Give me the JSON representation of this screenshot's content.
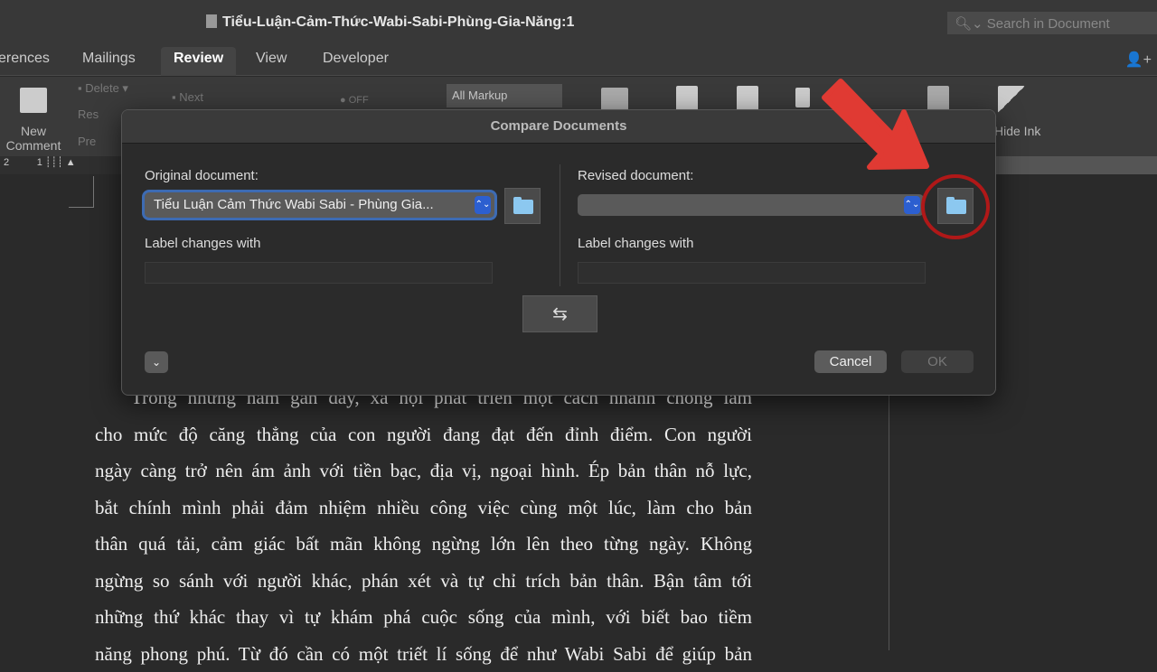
{
  "window": {
    "title": "Tiểu-Luận-Cảm-Thức-Wabi-Sabi-Phùng-Gia-Năng:1",
    "search_placeholder": "Search in Document"
  },
  "tabs": [
    {
      "label": "erences"
    },
    {
      "label": "Mailings"
    },
    {
      "label": "Review",
      "active": true
    },
    {
      "label": "View"
    },
    {
      "label": "Developer"
    }
  ],
  "ribbon": {
    "new_comment": "New Comment",
    "delete": "Delete",
    "next": "Next",
    "resolve": "Res",
    "previous": "Pre",
    "track_toggle": "OFF",
    "markup": "All Markup",
    "hide_ink": "Hide Ink"
  },
  "ruler": {
    "labels": [
      "2",
      "1"
    ]
  },
  "dialog": {
    "title": "Compare Documents",
    "original_label": "Original document:",
    "original_value": "Tiểu Luận Cảm Thức Wabi Sabi - Phùng Gia...",
    "revised_label": "Revised document:",
    "revised_value": "",
    "label_changes": "Label changes with",
    "cancel": "Cancel",
    "ok": "OK"
  },
  "document": {
    "lines": [
      "Trong những năm gần đây, xã hội phát triển một cách nhanh chóng làm",
      "cho mức độ căng thẳng của con người đang đạt đến đỉnh điểm. Con người",
      "ngày càng trở nên ám ảnh với tiền bạc, địa vị, ngoại hình. Ép bản thân nỗ lực,",
      "bắt chính mình phải đảm nhiệm nhiều công việc cùng một lúc, làm cho bản",
      "thân quá tải, cảm giác bất mãn không ngừng lớn lên theo từng ngày. Không",
      "ngừng so sánh với người khác, phán xét và tự chỉ trích bản thân. Bận tâm tới",
      "những thứ khác thay vì tự khám phá cuộc sống của mình, với biết bao tiềm",
      "năng phong phú. Từ đó cần có một triết lí sống để như Wabi Sabi để giúp bản"
    ]
  },
  "annotation": {
    "color": "#e03a33",
    "circle_color": "#b01818"
  }
}
